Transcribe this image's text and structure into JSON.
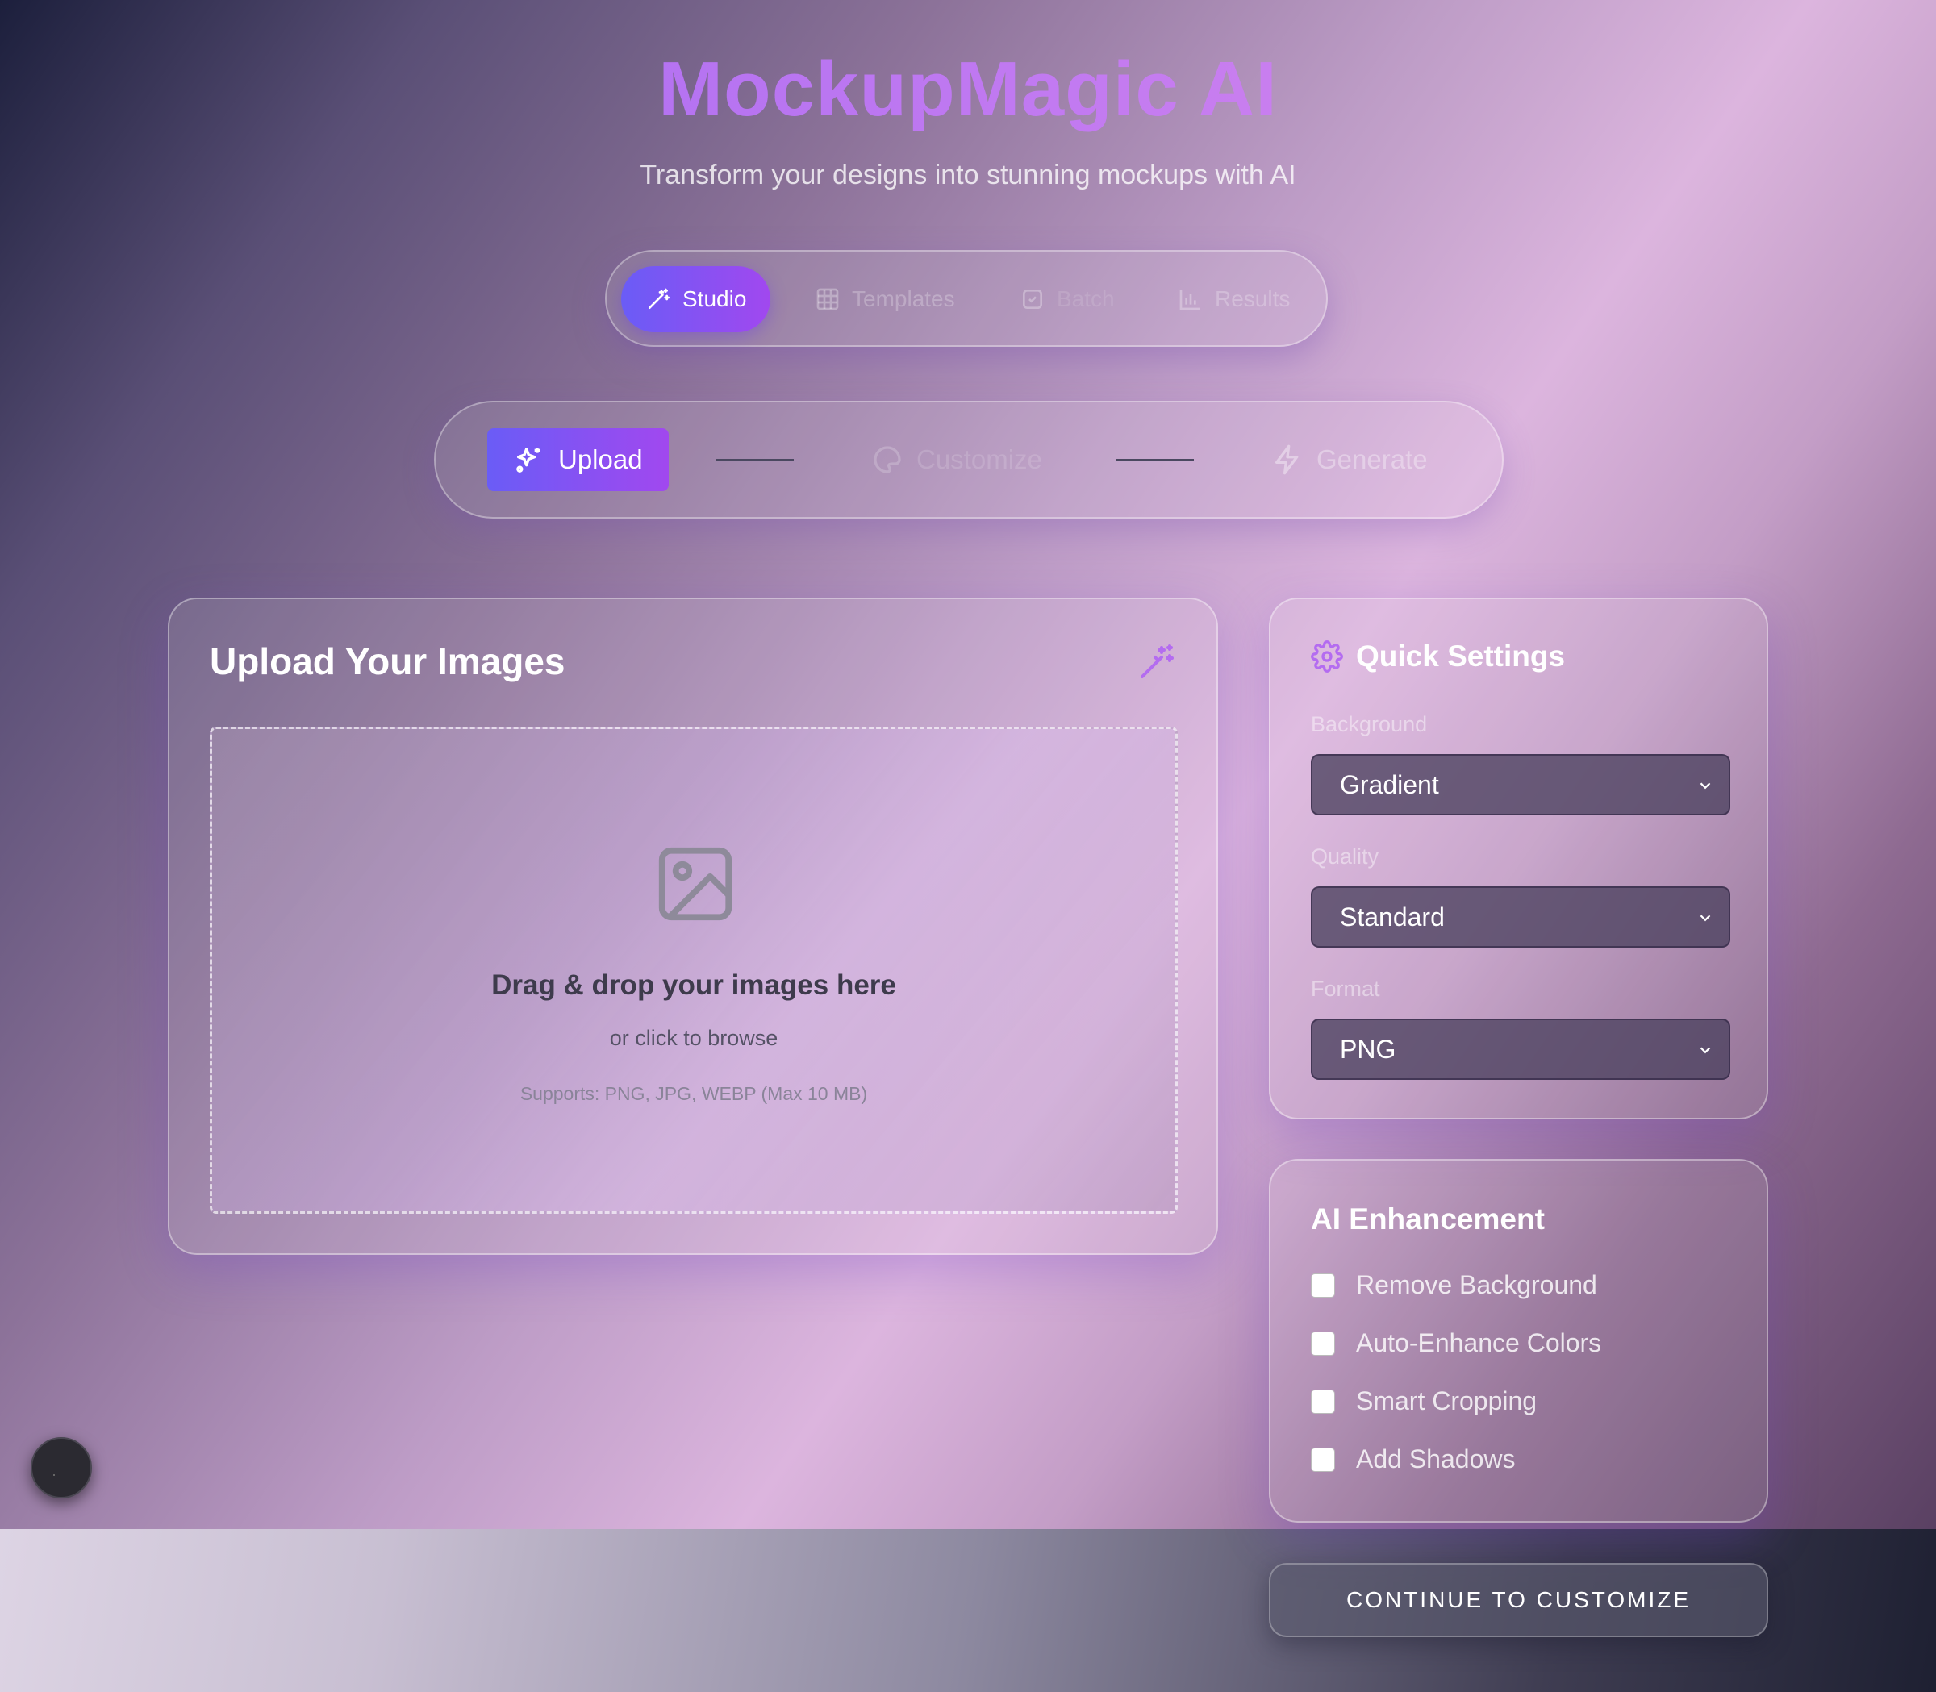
{
  "header": {
    "title": "MockupMagic AI",
    "subtitle": "Transform your designs into stunning mockups with AI"
  },
  "nav": {
    "tabs": [
      {
        "label": "Studio",
        "icon": "magic-wand-icon",
        "active": true
      },
      {
        "label": "Templates",
        "icon": "grid-icon",
        "active": false
      },
      {
        "label": "Batch",
        "icon": "layers-icon",
        "active": false
      },
      {
        "label": "Results",
        "icon": "bar-chart-icon",
        "active": false
      }
    ]
  },
  "steps": [
    {
      "label": "Upload",
      "icon": "sparkles-icon",
      "active": true
    },
    {
      "label": "Customize",
      "icon": "palette-icon",
      "active": false
    },
    {
      "label": "Generate",
      "icon": "lightning-icon",
      "active": false
    }
  ],
  "upload": {
    "title": "Upload Your Images",
    "drop_title": "Drag & drop your images here",
    "drop_subtitle": "or click to browse",
    "supports": "Supports: PNG, JPG, WEBP (Max 10 MB)"
  },
  "quick_settings": {
    "title": "Quick Settings",
    "fields": [
      {
        "label": "Background",
        "value": "Gradient"
      },
      {
        "label": "Quality",
        "value": "Standard"
      },
      {
        "label": "Format",
        "value": "PNG"
      }
    ]
  },
  "ai_enhancement": {
    "title": "AI Enhancement",
    "options": [
      {
        "label": "Remove Background",
        "checked": false
      },
      {
        "label": "Auto-Enhance Colors",
        "checked": false
      },
      {
        "label": "Smart Cropping",
        "checked": false
      },
      {
        "label": "Add Shadows",
        "checked": false
      }
    ]
  },
  "actions": {
    "continue_label": "CONTINUE TO CUSTOMIZE"
  },
  "colors": {
    "accent_start": "#6a5cf6",
    "accent_end": "#a148ef",
    "title_gradient_start": "#a067f2",
    "title_gradient_end": "#de8ce8"
  }
}
